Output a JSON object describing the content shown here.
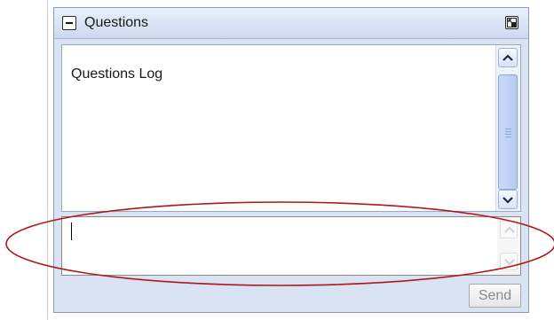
{
  "panel": {
    "title": "Questions",
    "collapse_icon": "minus-box-icon",
    "popout_icon": "popout-window-icon"
  },
  "log": {
    "text": "Questions Log",
    "scroll_up_icon": "chevron-up-icon",
    "scroll_down_icon": "chevron-down-icon"
  },
  "input": {
    "value": ""
  },
  "actions": {
    "send_label": "Send"
  },
  "colors": {
    "panel_bg": "#d9e3f3",
    "scroll_thumb": "#b7cbf2",
    "annotation_ellipse": "#b01818"
  }
}
